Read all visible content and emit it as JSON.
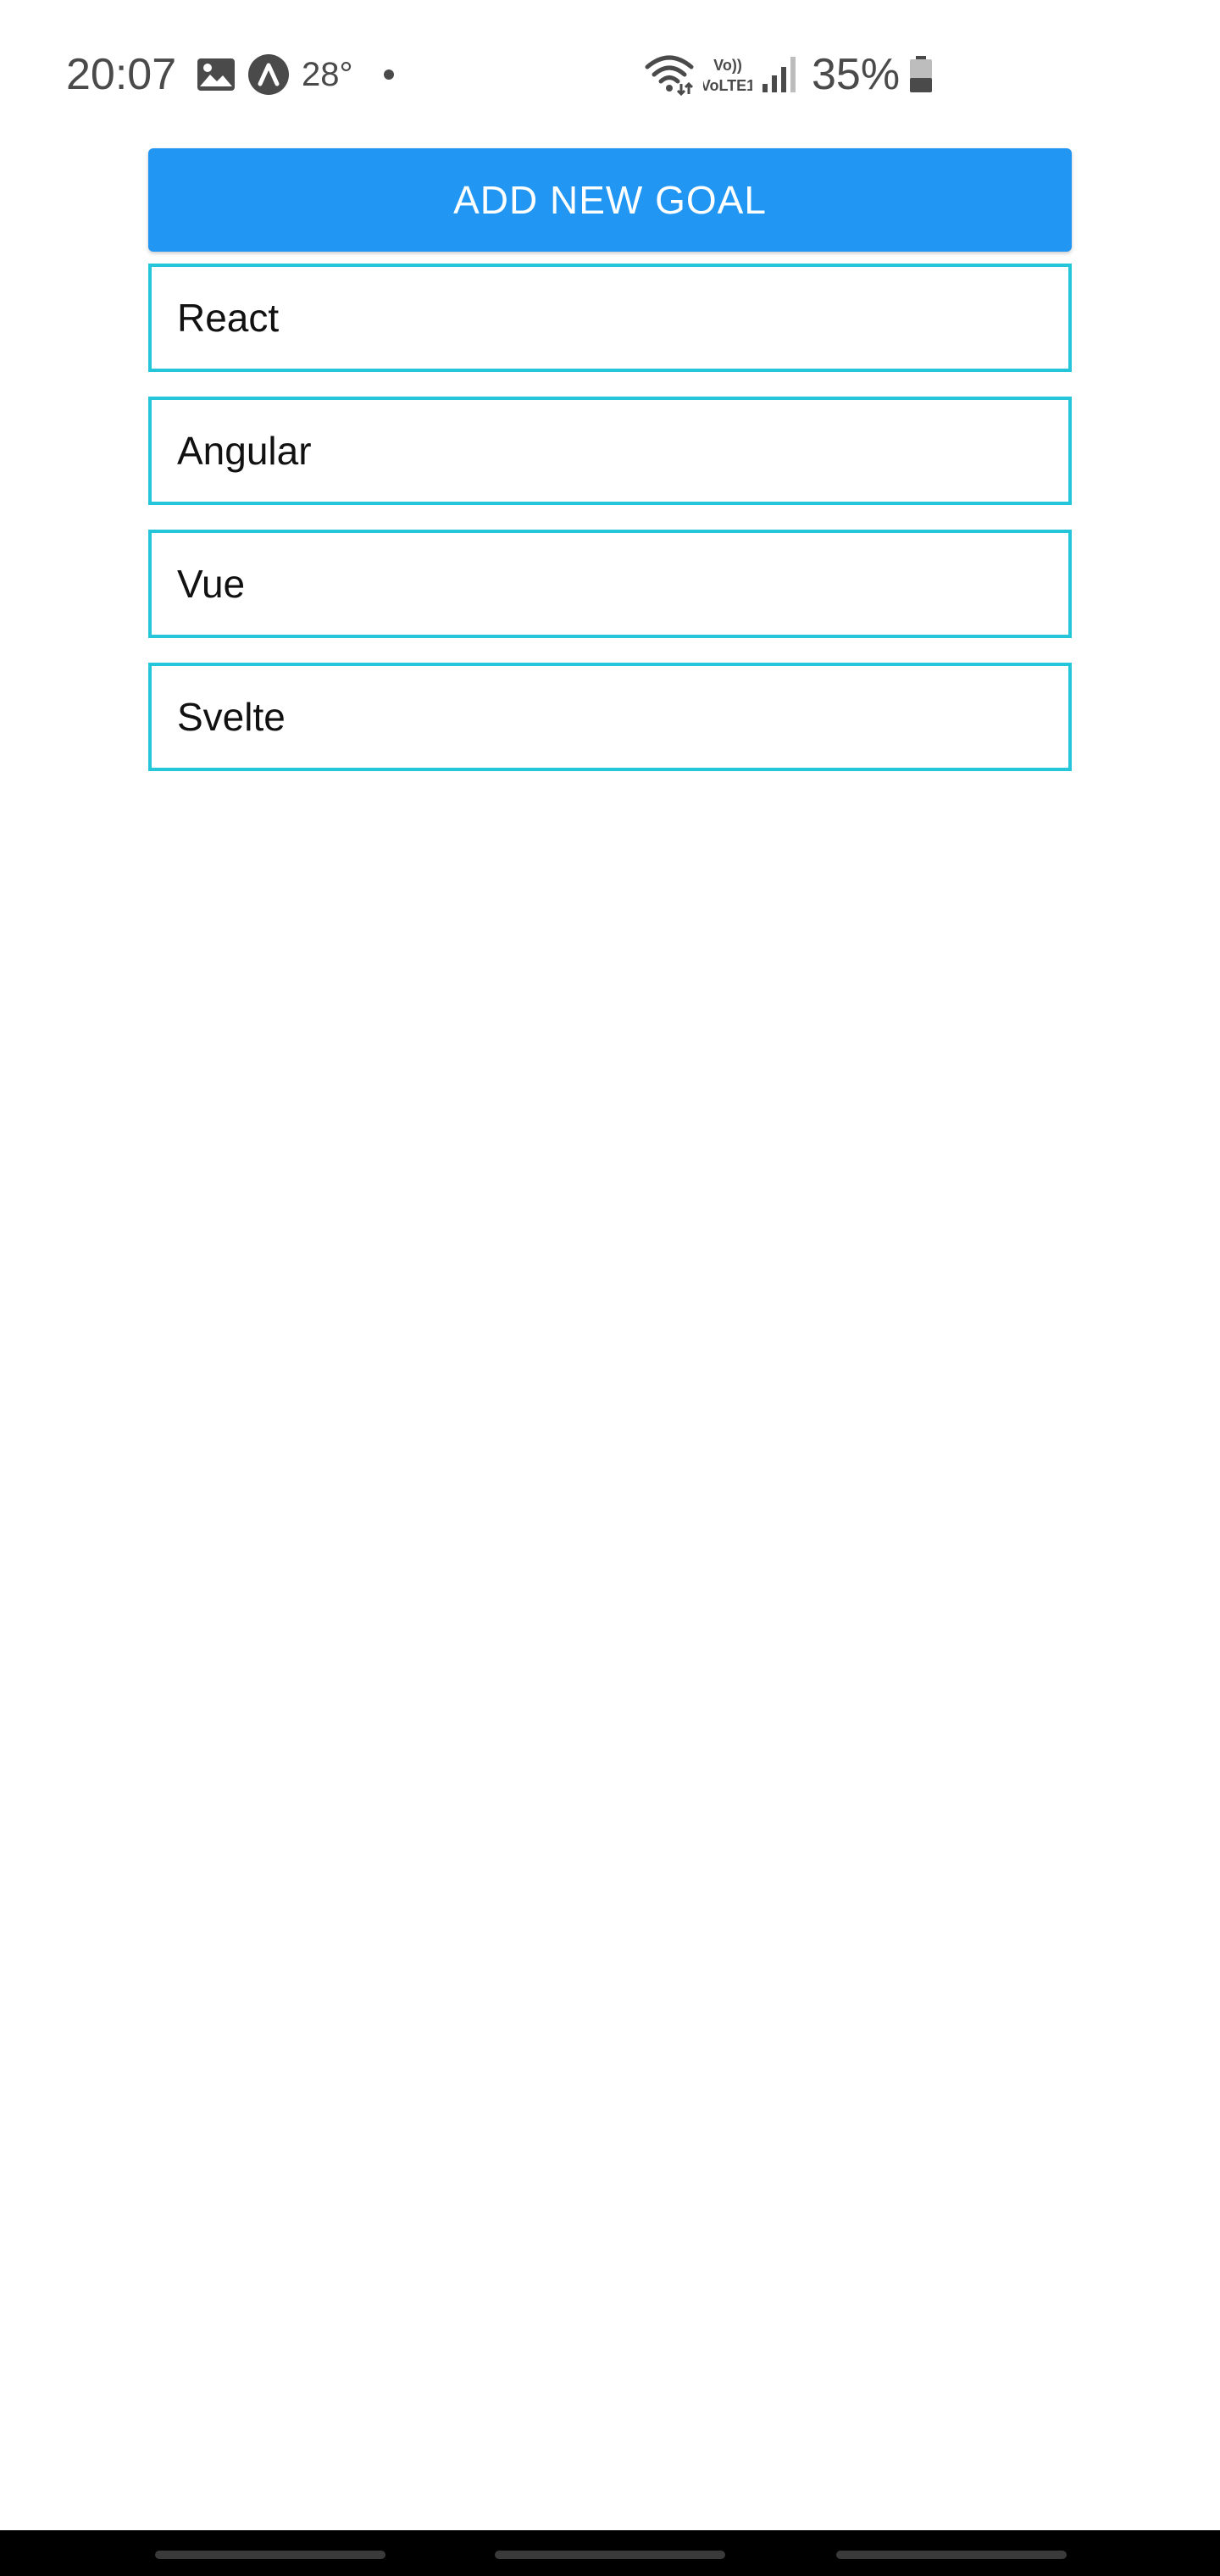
{
  "status_bar": {
    "time": "20:07",
    "temperature": "28°",
    "battery_percent": "35%",
    "network_label": "VoLTE1",
    "battery_level": 0.35,
    "icons": [
      "gallery-icon",
      "a-badge-icon",
      "notification-dot",
      "wifi-icon",
      "volte-icon",
      "signal-icon",
      "battery-icon"
    ]
  },
  "main": {
    "add_goal_label": "ADD NEW GOAL",
    "goals": [
      {
        "label": "React"
      },
      {
        "label": "Angular"
      },
      {
        "label": "Vue"
      },
      {
        "label": "Svelte"
      }
    ]
  },
  "colors": {
    "button": "#2196f3",
    "goal_border": "#26c6da",
    "status_text": "#4a4a4a"
  }
}
